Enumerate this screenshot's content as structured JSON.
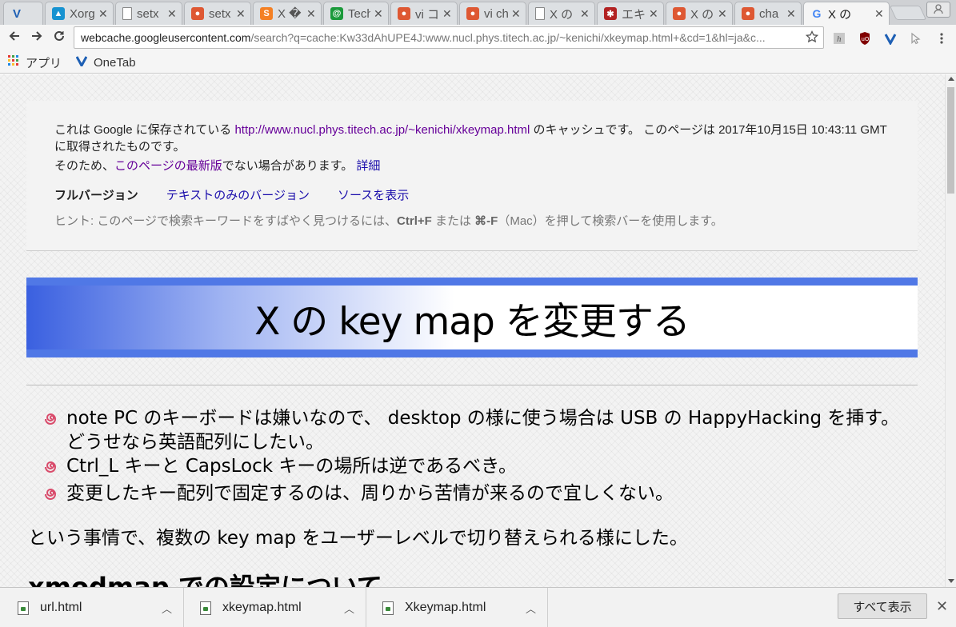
{
  "tabs": [
    {
      "title": "",
      "favicon": "vivaldi-icon",
      "color": "#1d5fb4",
      "active": false
    },
    {
      "title": "Xorg",
      "favicon": "arch-icon",
      "color": "#1793d1",
      "active": false
    },
    {
      "title": "setx",
      "favicon": "page-icon",
      "color": "#888888",
      "active": false
    },
    {
      "title": "setx",
      "favicon": "ddg-icon",
      "color": "#de5833",
      "active": false
    },
    {
      "title": "X �",
      "favicon": "stackoverflow-icon",
      "color": "#f48024",
      "active": false
    },
    {
      "title": "Tech",
      "favicon": "techbase-icon",
      "color": "#1b9a3b",
      "active": false
    },
    {
      "title": "vi コ",
      "favicon": "ddg-icon",
      "color": "#de5833",
      "active": false
    },
    {
      "title": "vi ch",
      "favicon": "ddg-icon",
      "color": "#de5833",
      "active": false
    },
    {
      "title": "X の",
      "favicon": "page-icon",
      "color": "#888888",
      "active": false
    },
    {
      "title": "エキ",
      "favicon": "bug-icon",
      "color": "#b22222",
      "active": false
    },
    {
      "title": "X の",
      "favicon": "ddg-icon",
      "color": "#de5833",
      "active": false
    },
    {
      "title": "cha",
      "favicon": "ddg-icon",
      "color": "#de5833",
      "active": false
    },
    {
      "title": "X の",
      "favicon": "google-icon",
      "color": "#4285f4",
      "active": true
    }
  ],
  "toolbar": {
    "url_host": "webcache.googleusercontent.com",
    "url_rest": "/search?q=cache:Kw33dAhUPE4J:www.nucl.phys.titech.ac.jp/~kenichi/xkeymap.html+&cd=1&hl=ja&c..."
  },
  "bookmarks": [
    {
      "label": "アプリ",
      "icon": "apps-grid-icon"
    },
    {
      "label": "OneTab",
      "icon": "onetab-icon"
    }
  ],
  "cache": {
    "prefix": "これは Google に保存されている ",
    "link": "http://www.nucl.phys.titech.ac.jp/~kenichi/xkeymap.html",
    "suffix": " のキャッシュです。 このページは 2017年10月15日 10:43:11 GMT に取得されたものです。",
    "line2_prefix": "そのため、",
    "line2_link": "このページの最新版",
    "line2_suffix": "でない場合があります。 ",
    "details": "詳細",
    "full_version": "フルバージョン",
    "text_version": "テキストのみのバージョン",
    "view_source": "ソースを表示",
    "hint_prefix": "ヒント: このページで検索キーワードをすばやく見つけるには、",
    "hint_key1": "Ctrl+F",
    "hint_mid": " または ",
    "hint_key2": "⌘-F",
    "hint_suffix": "（Mac）を押して検索バーを使用します。"
  },
  "article": {
    "title": "X の key map を変更する",
    "bullets": [
      "note PC のキーボードは嫌いなので、 desktop の様に使う場合は USB の HappyHacking を挿す。 どうせなら英語配列にしたい。",
      "Ctrl_L キーと CapsLock キーの場所は逆であるべき。",
      "変更したキー配列で固定するのは、周りから苦情が来るので宜しくない。"
    ],
    "paragraph": "という事情で、複数の key map をユーザーレベルで切り替えられる様にした。",
    "section_heading": "xmodmap での設定について"
  },
  "downloads": {
    "items": [
      "url.html",
      "xkeymap.html",
      "Xkeymap.html"
    ],
    "show_all": "すべて表示"
  }
}
